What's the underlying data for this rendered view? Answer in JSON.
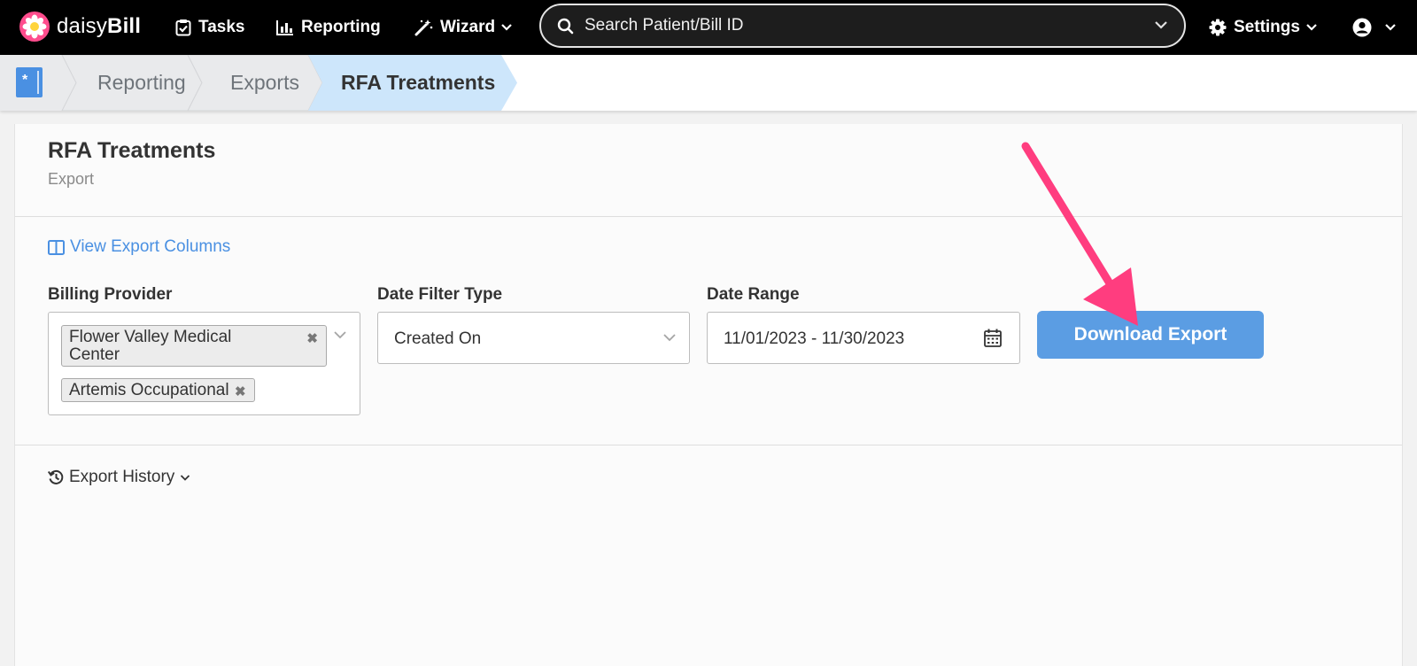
{
  "nav": {
    "brand_prefix": "daisy",
    "brand_suffix": "Bill",
    "tasks": "Tasks",
    "reporting": "Reporting",
    "wizard": "Wizard",
    "search_placeholder": "Search Patient/Bill ID",
    "settings": "Settings"
  },
  "breadcrumb": {
    "home_icon": "document-icon",
    "items": [
      {
        "label": "Reporting"
      },
      {
        "label": "Exports"
      },
      {
        "label": "RFA Treatments"
      }
    ]
  },
  "page": {
    "title": "RFA Treatments",
    "subtitle": "Export",
    "view_columns": "View Export Columns"
  },
  "form": {
    "billing_provider": {
      "label": "Billing Provider",
      "tags": [
        {
          "line1": "Flower Valley Medical",
          "line2": "Center"
        },
        {
          "line1": "Artemis Occupational"
        }
      ]
    },
    "date_filter_type": {
      "label": "Date Filter Type",
      "value": "Created On"
    },
    "date_range": {
      "label": "Date Range",
      "value": "11/01/2023 - 11/30/2023"
    },
    "download_button": "Download Export"
  },
  "history": {
    "label": "Export History"
  },
  "colors": {
    "accent": "#4a90e2",
    "button": "#5b9de3",
    "active_crumb": "#cde6fb",
    "arrow": "#ff3d7f"
  }
}
